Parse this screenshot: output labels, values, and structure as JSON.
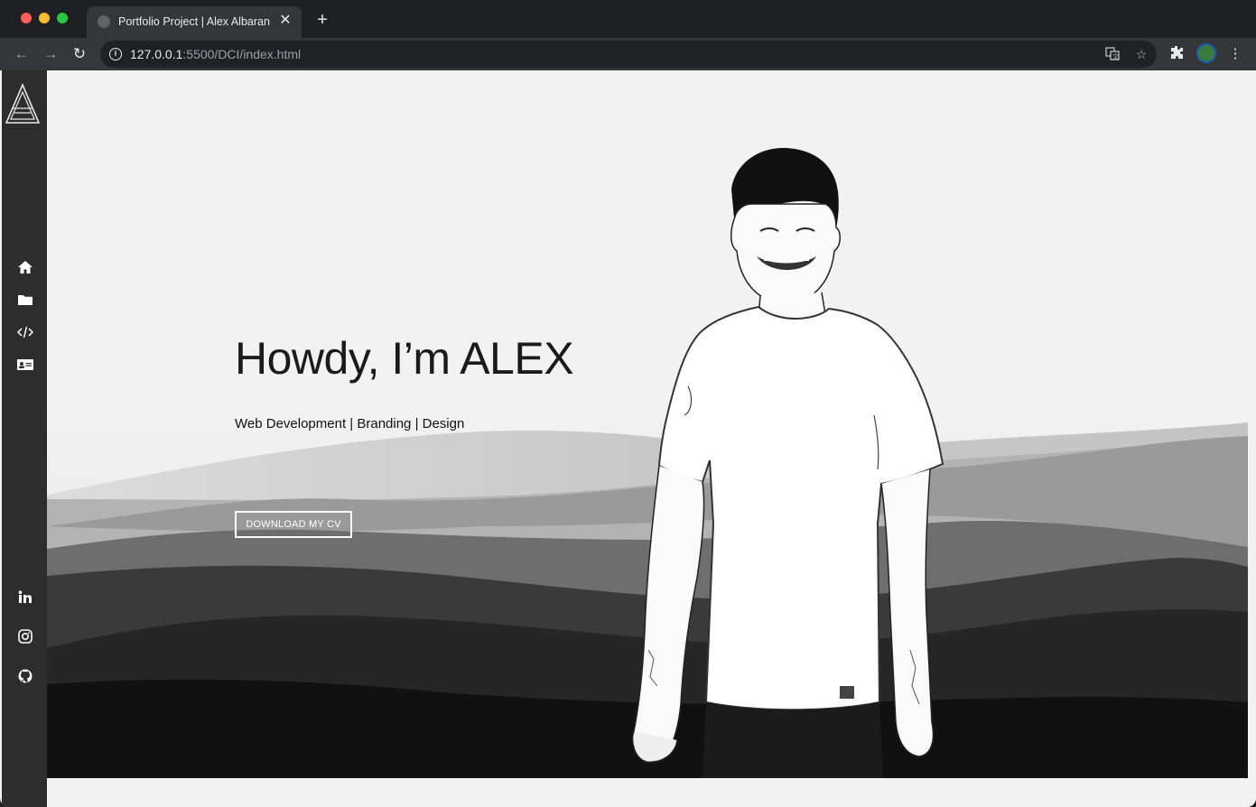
{
  "browser": {
    "tab_title": "Portfolio Project | Alex Albaran",
    "close_glyph": "✕",
    "new_tab_glyph": "+",
    "url_host": "127.0.0.1",
    "url_rest": ":5500/DCI/index.html",
    "back_glyph": "←",
    "forward_glyph": "→",
    "reload_glyph": "↻",
    "menu_glyph": "⋮"
  },
  "sidebar": {
    "logo": "aa-triangle-logo",
    "nav_items": [
      {
        "icon": "home-icon"
      },
      {
        "icon": "folder-icon"
      },
      {
        "icon": "code-icon"
      },
      {
        "icon": "id-card-icon"
      }
    ],
    "social_items": [
      {
        "icon": "linkedin-icon"
      },
      {
        "icon": "instagram-icon"
      },
      {
        "icon": "github-icon"
      }
    ]
  },
  "hero": {
    "headline": "Howdy, I’m ALEX",
    "subline": "Web Development | Branding | Design",
    "cv_button": "DOWNLOAD MY CV"
  },
  "colors": {
    "sidebar_bg": "#2d2d2d",
    "page_bg": "#f2f2f2",
    "browser_frame": "#35363a"
  }
}
